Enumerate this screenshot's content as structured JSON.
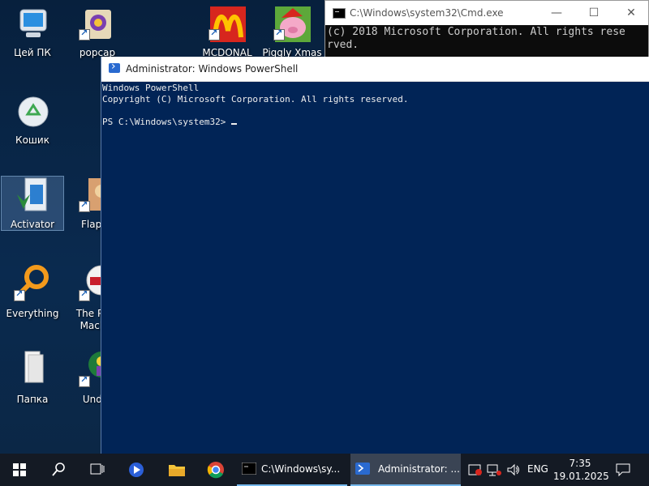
{
  "desktop": {
    "icons": [
      {
        "label": "Цей ПК"
      },
      {
        "label": "popcap"
      },
      {
        "label": "MCDONAL"
      },
      {
        "label": "Piggly Xmas"
      },
      {
        "label": "Кошик"
      },
      {
        "label": "Activator"
      },
      {
        "label": "Flappy"
      },
      {
        "label": "Everything"
      },
      {
        "label": "The Po… Machin"
      },
      {
        "label": "Папка"
      },
      {
        "label": "Under"
      }
    ]
  },
  "cmd_window": {
    "title": "C:\\Windows\\system32\\Cmd.exe",
    "line1": "(c) 2018 Microsoft Corporation. All rights rese",
    "line2": "rved."
  },
  "powershell_window": {
    "title": "Administrator: Windows PowerShell",
    "line1": "Windows PowerShell",
    "line2": "Copyright (C) Microsoft Corporation. All rights reserved.",
    "prompt": "PS C:\\Windows\\system32> "
  },
  "taskbar": {
    "apps": [
      {
        "label": "C:\\Windows\\sy..."
      },
      {
        "label": "Administrator: ..."
      }
    ],
    "language": "ENG",
    "time": "7:35",
    "date": "19.01.2025"
  },
  "colors": {
    "powershell_bg": "#012456",
    "taskbar_bg": "#141a24",
    "accent": "#76b9ed"
  }
}
